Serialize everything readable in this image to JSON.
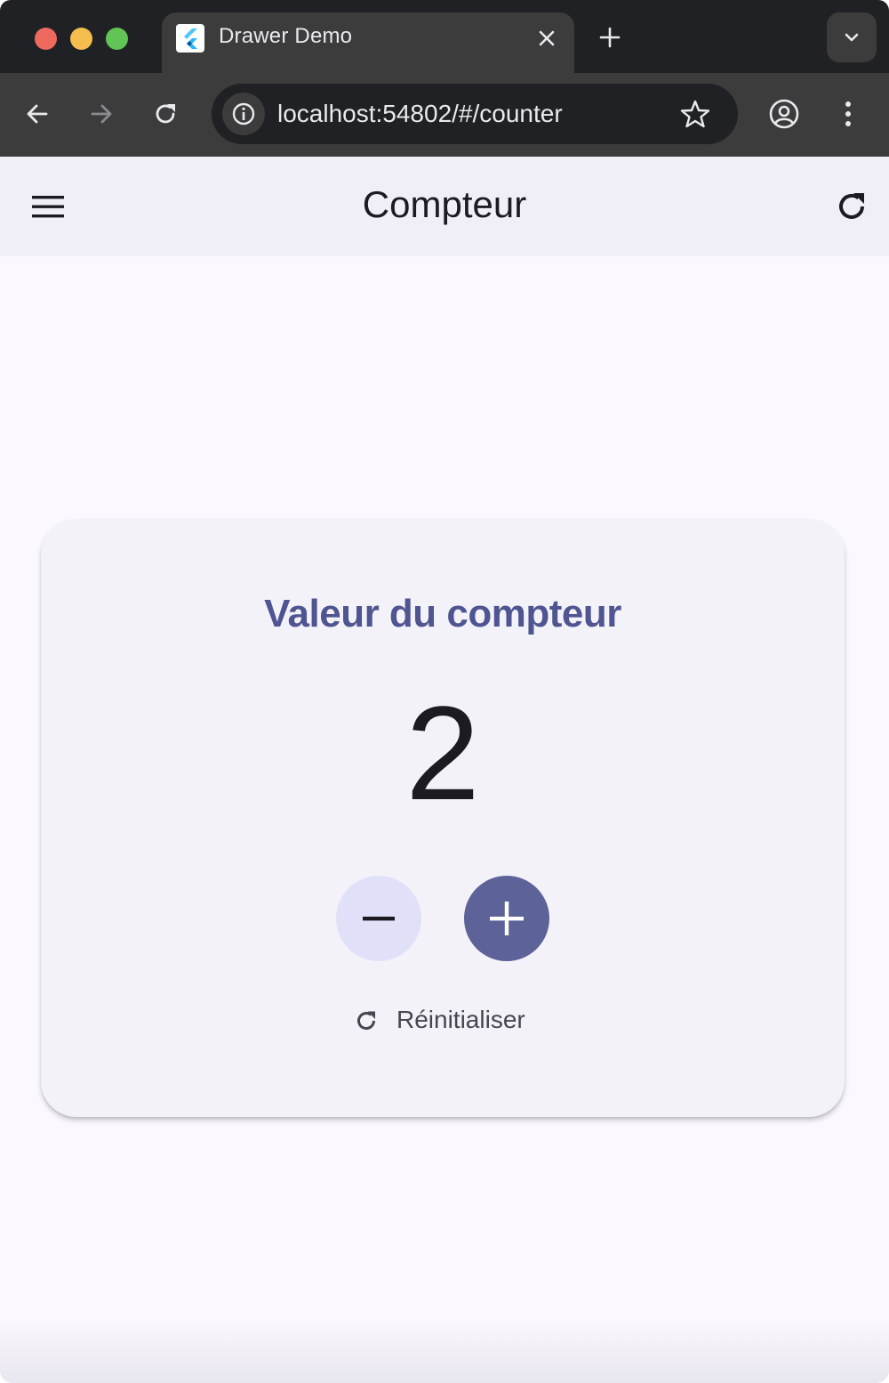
{
  "browser": {
    "tab_title": "Drawer Demo",
    "url": "localhost:54802/#/counter"
  },
  "app": {
    "title": "Compteur"
  },
  "card": {
    "title": "Valeur du compteur",
    "value": "2",
    "reset_label": "Réinitialiser"
  },
  "colors": {
    "primary": "#5d6399",
    "primary_text": "#4f5590",
    "secondary_container": "#e0e0f8",
    "surface": "#fbf8ff",
    "card": "#f4f2f9",
    "appbar": "#f0eff8"
  },
  "icons": {
    "menu": "menu-icon",
    "refresh": "refresh-icon",
    "decrement": "minus-icon",
    "increment": "plus-icon",
    "reset": "refresh-icon"
  }
}
